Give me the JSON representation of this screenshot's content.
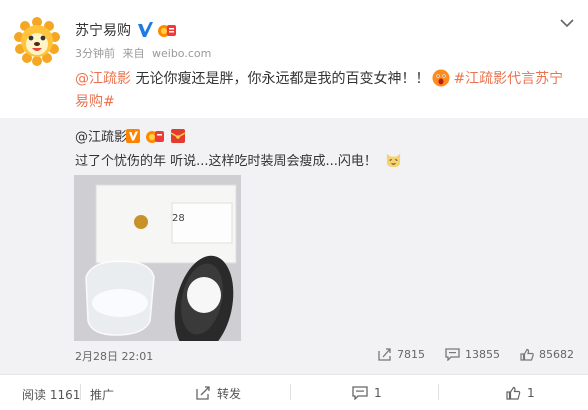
{
  "post": {
    "author": "苏宁易购",
    "time_ago": "3分钟前",
    "source_prefix": "来自",
    "source": "weibo.com",
    "text_mention": "@江疏影",
    "text_body": " 无论你瘦还是胖，你永远都是我的百变女神！！",
    "text_hashtag": "#江疏影代言苏宁易购#"
  },
  "repost": {
    "author": "@江疏影",
    "text": "过了个忧伤的年 听说...这样吃时装周会瘦成...闪电！",
    "image_label": "28",
    "date": "2月28日 22:01",
    "shares": "7815",
    "comments": "13855",
    "likes": "85682"
  },
  "footer": {
    "read_label": "阅读 1161",
    "promote_label": "推广",
    "repost_label": "转发",
    "comment_count": "1",
    "like_count": "1"
  },
  "colors": {
    "accent": "#eb7350",
    "verified": "#1f7be0",
    "repost_bg": "#f2f2f5"
  }
}
